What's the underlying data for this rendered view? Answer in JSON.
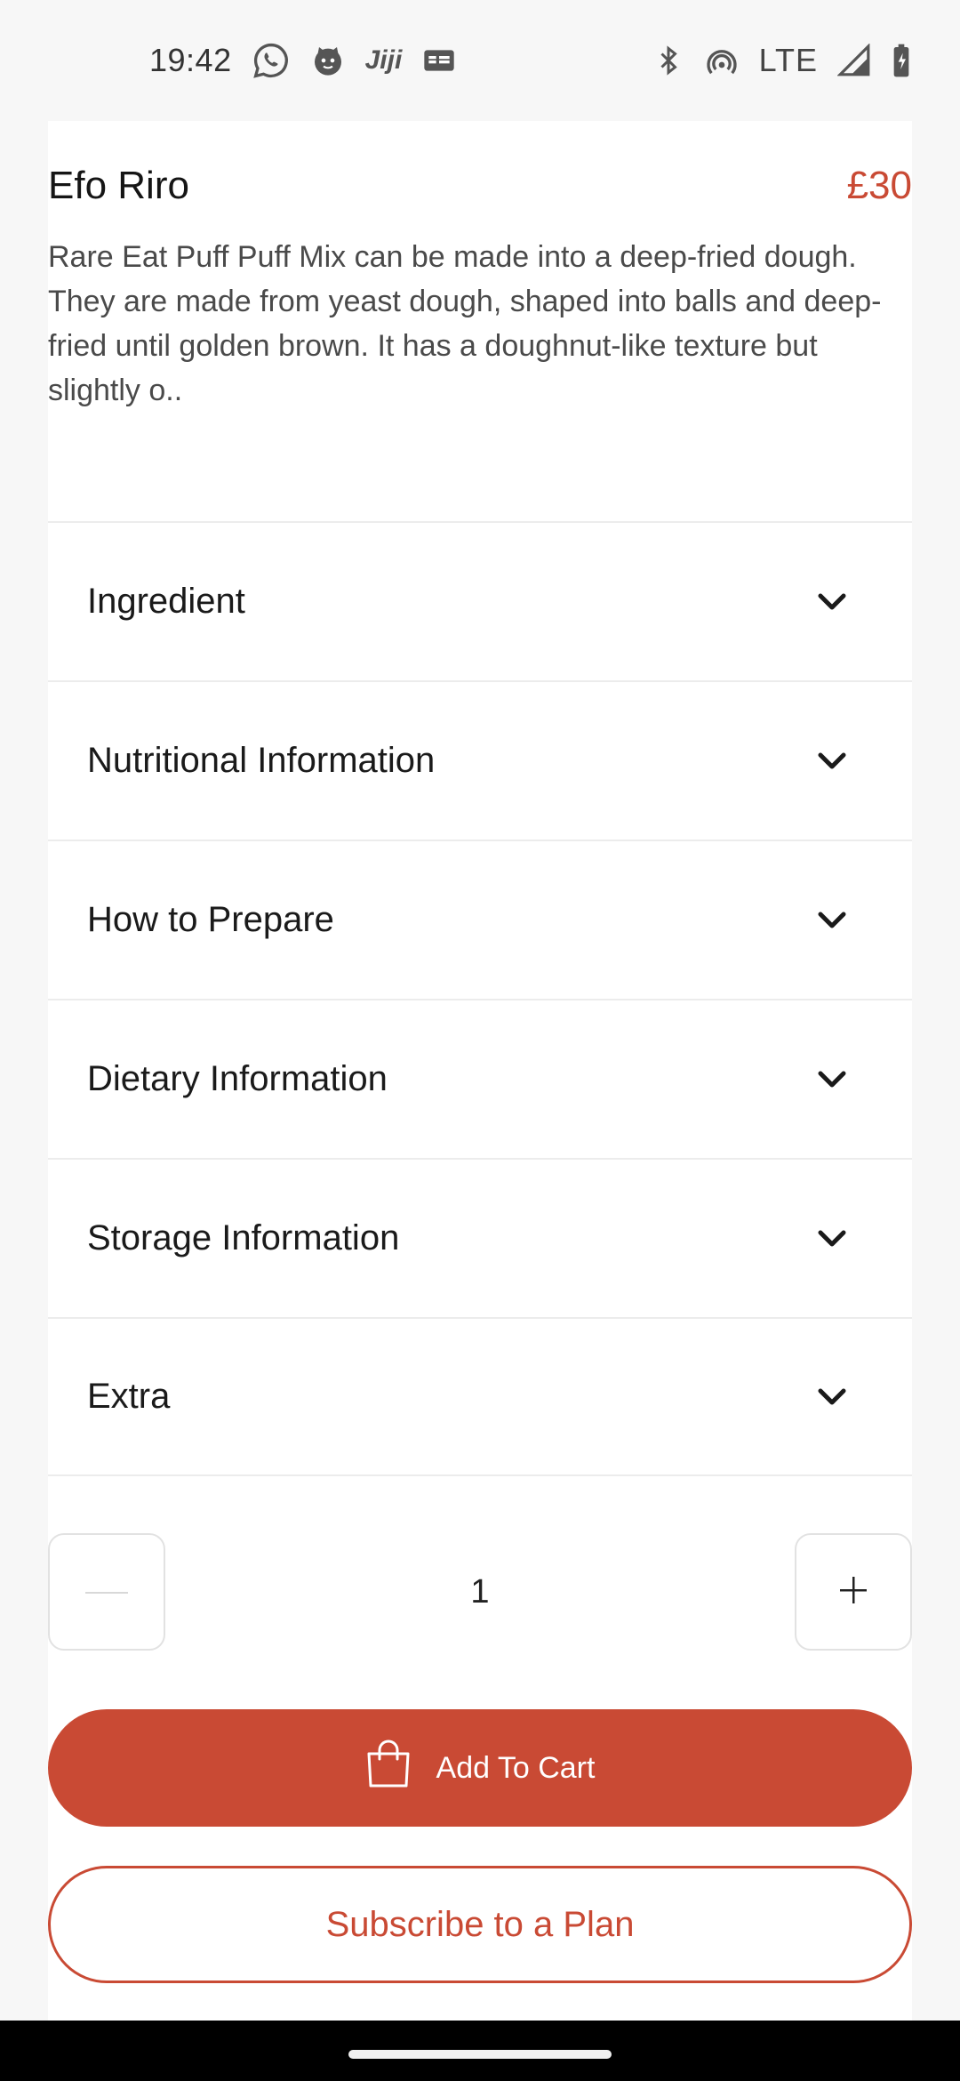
{
  "status_bar": {
    "time": "19:42",
    "app_icons": [
      "whatsapp-icon",
      "cat-face-icon",
      "jiji-icon",
      "news-icon"
    ],
    "jiji_text": "Jiji",
    "network": "LTE",
    "system_icons": [
      "bluetooth-icon",
      "hotspot-icon",
      "signal-icon",
      "battery-charging-icon"
    ]
  },
  "product": {
    "name": "Efo Riro",
    "price": "£30",
    "description": "Rare Eat Puff Puff Mix can be made into a deep-fried dough. They are made from yeast dough, shaped into balls and deep-fried until golden brown. It has a doughnut-like texture but slightly o.."
  },
  "accordion": [
    {
      "label": "Ingredient"
    },
    {
      "label": "Nutritional Information"
    },
    {
      "label": "How to Prepare"
    },
    {
      "label": "Dietary Information"
    },
    {
      "label": "Storage Information"
    },
    {
      "label": "Extra"
    }
  ],
  "quantity": {
    "value": "1"
  },
  "actions": {
    "add_to_cart": "Add To Cart",
    "subscribe": "Subscribe to a Plan"
  },
  "colors": {
    "accent": "#c94a34",
    "background": "#f7f7f7",
    "card": "#ffffff"
  }
}
